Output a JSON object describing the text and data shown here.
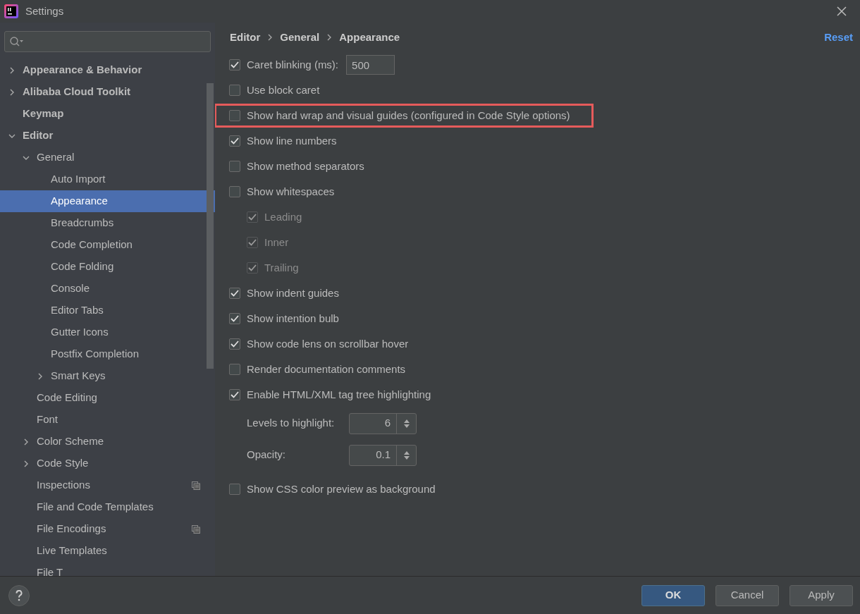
{
  "window": {
    "title": "Settings"
  },
  "tree": [
    {
      "label": "Appearance & Behavior",
      "bold": true,
      "expanded": false,
      "has_children": true,
      "selected": false
    },
    {
      "label": "Alibaba Cloud Toolkit",
      "bold": true,
      "expanded": false,
      "has_children": true,
      "selected": false
    },
    {
      "label": "Keymap",
      "bold": true,
      "has_children": false,
      "selected": false
    },
    {
      "label": "Editor",
      "bold": true,
      "expanded": true,
      "has_children": true,
      "selected": false,
      "children": [
        {
          "label": "General",
          "expanded": true,
          "has_children": true,
          "selected": false,
          "children": [
            {
              "label": "Auto Import",
              "selected": false
            },
            {
              "label": "Appearance",
              "selected": true
            },
            {
              "label": "Breadcrumbs",
              "selected": false
            },
            {
              "label": "Code Completion",
              "selected": false
            },
            {
              "label": "Code Folding",
              "selected": false
            },
            {
              "label": "Console",
              "selected": false
            },
            {
              "label": "Editor Tabs",
              "selected": false
            },
            {
              "label": "Gutter Icons",
              "selected": false
            },
            {
              "label": "Postfix Completion",
              "selected": false
            },
            {
              "label": "Smart Keys",
              "has_children": true,
              "expanded": false,
              "selected": false
            }
          ]
        },
        {
          "label": "Code Editing",
          "selected": false
        },
        {
          "label": "Font",
          "selected": false
        },
        {
          "label": "Color Scheme",
          "has_children": true,
          "expanded": false,
          "selected": false
        },
        {
          "label": "Code Style",
          "has_children": true,
          "expanded": false,
          "selected": false
        },
        {
          "label": "Inspections",
          "project_scope": true,
          "selected": false
        },
        {
          "label": "File and Code Templates",
          "selected": false
        },
        {
          "label": "File Encodings",
          "project_scope": true,
          "selected": false
        },
        {
          "label": "Live Templates",
          "selected": false
        },
        {
          "label": "File T",
          "selected": false
        }
      ]
    }
  ],
  "breadcrumb": [
    "Editor",
    "General",
    "Appearance"
  ],
  "reset": "Reset",
  "options": [
    {
      "kind": "checkbox",
      "label": "Caret blinking (ms):",
      "checked": true,
      "value": "500"
    },
    {
      "kind": "checkbox",
      "label": "Use block caret",
      "checked": false
    },
    {
      "kind": "checkbox",
      "label": "Show hard wrap and visual guides (configured in Code Style options)",
      "checked": false,
      "highlighted": true
    },
    {
      "kind": "checkbox",
      "label": "Show line numbers",
      "checked": true
    },
    {
      "kind": "checkbox",
      "label": "Show method separators",
      "checked": false
    },
    {
      "kind": "checkbox",
      "label": "Show whitespaces",
      "checked": false,
      "children": [
        {
          "kind": "checkbox",
          "label": "Leading",
          "checked": true,
          "disabled": true
        },
        {
          "kind": "checkbox",
          "label": "Inner",
          "checked": true,
          "disabled": true
        },
        {
          "kind": "checkbox",
          "label": "Trailing",
          "checked": true,
          "disabled": true
        }
      ]
    },
    {
      "kind": "checkbox",
      "label": "Show indent guides",
      "checked": true
    },
    {
      "kind": "checkbox",
      "label": "Show intention bulb",
      "checked": true
    },
    {
      "kind": "checkbox",
      "label": "Show code lens on scrollbar hover",
      "checked": true
    },
    {
      "kind": "checkbox",
      "label": "Render documentation comments",
      "checked": false
    },
    {
      "kind": "checkbox",
      "label": "Enable HTML/XML tag tree highlighting",
      "checked": true,
      "children": [
        {
          "kind": "spinner",
          "label": "Levels to highlight:",
          "value": "6"
        },
        {
          "kind": "spinner",
          "label": "Opacity:",
          "value": "0.1"
        }
      ]
    },
    {
      "kind": "checkbox",
      "label": "Show CSS color preview as background",
      "checked": false
    }
  ],
  "buttons": [
    {
      "label": "OK",
      "primary": true
    },
    {
      "label": "Cancel",
      "primary": false
    },
    {
      "label": "Apply",
      "primary": false
    }
  ]
}
